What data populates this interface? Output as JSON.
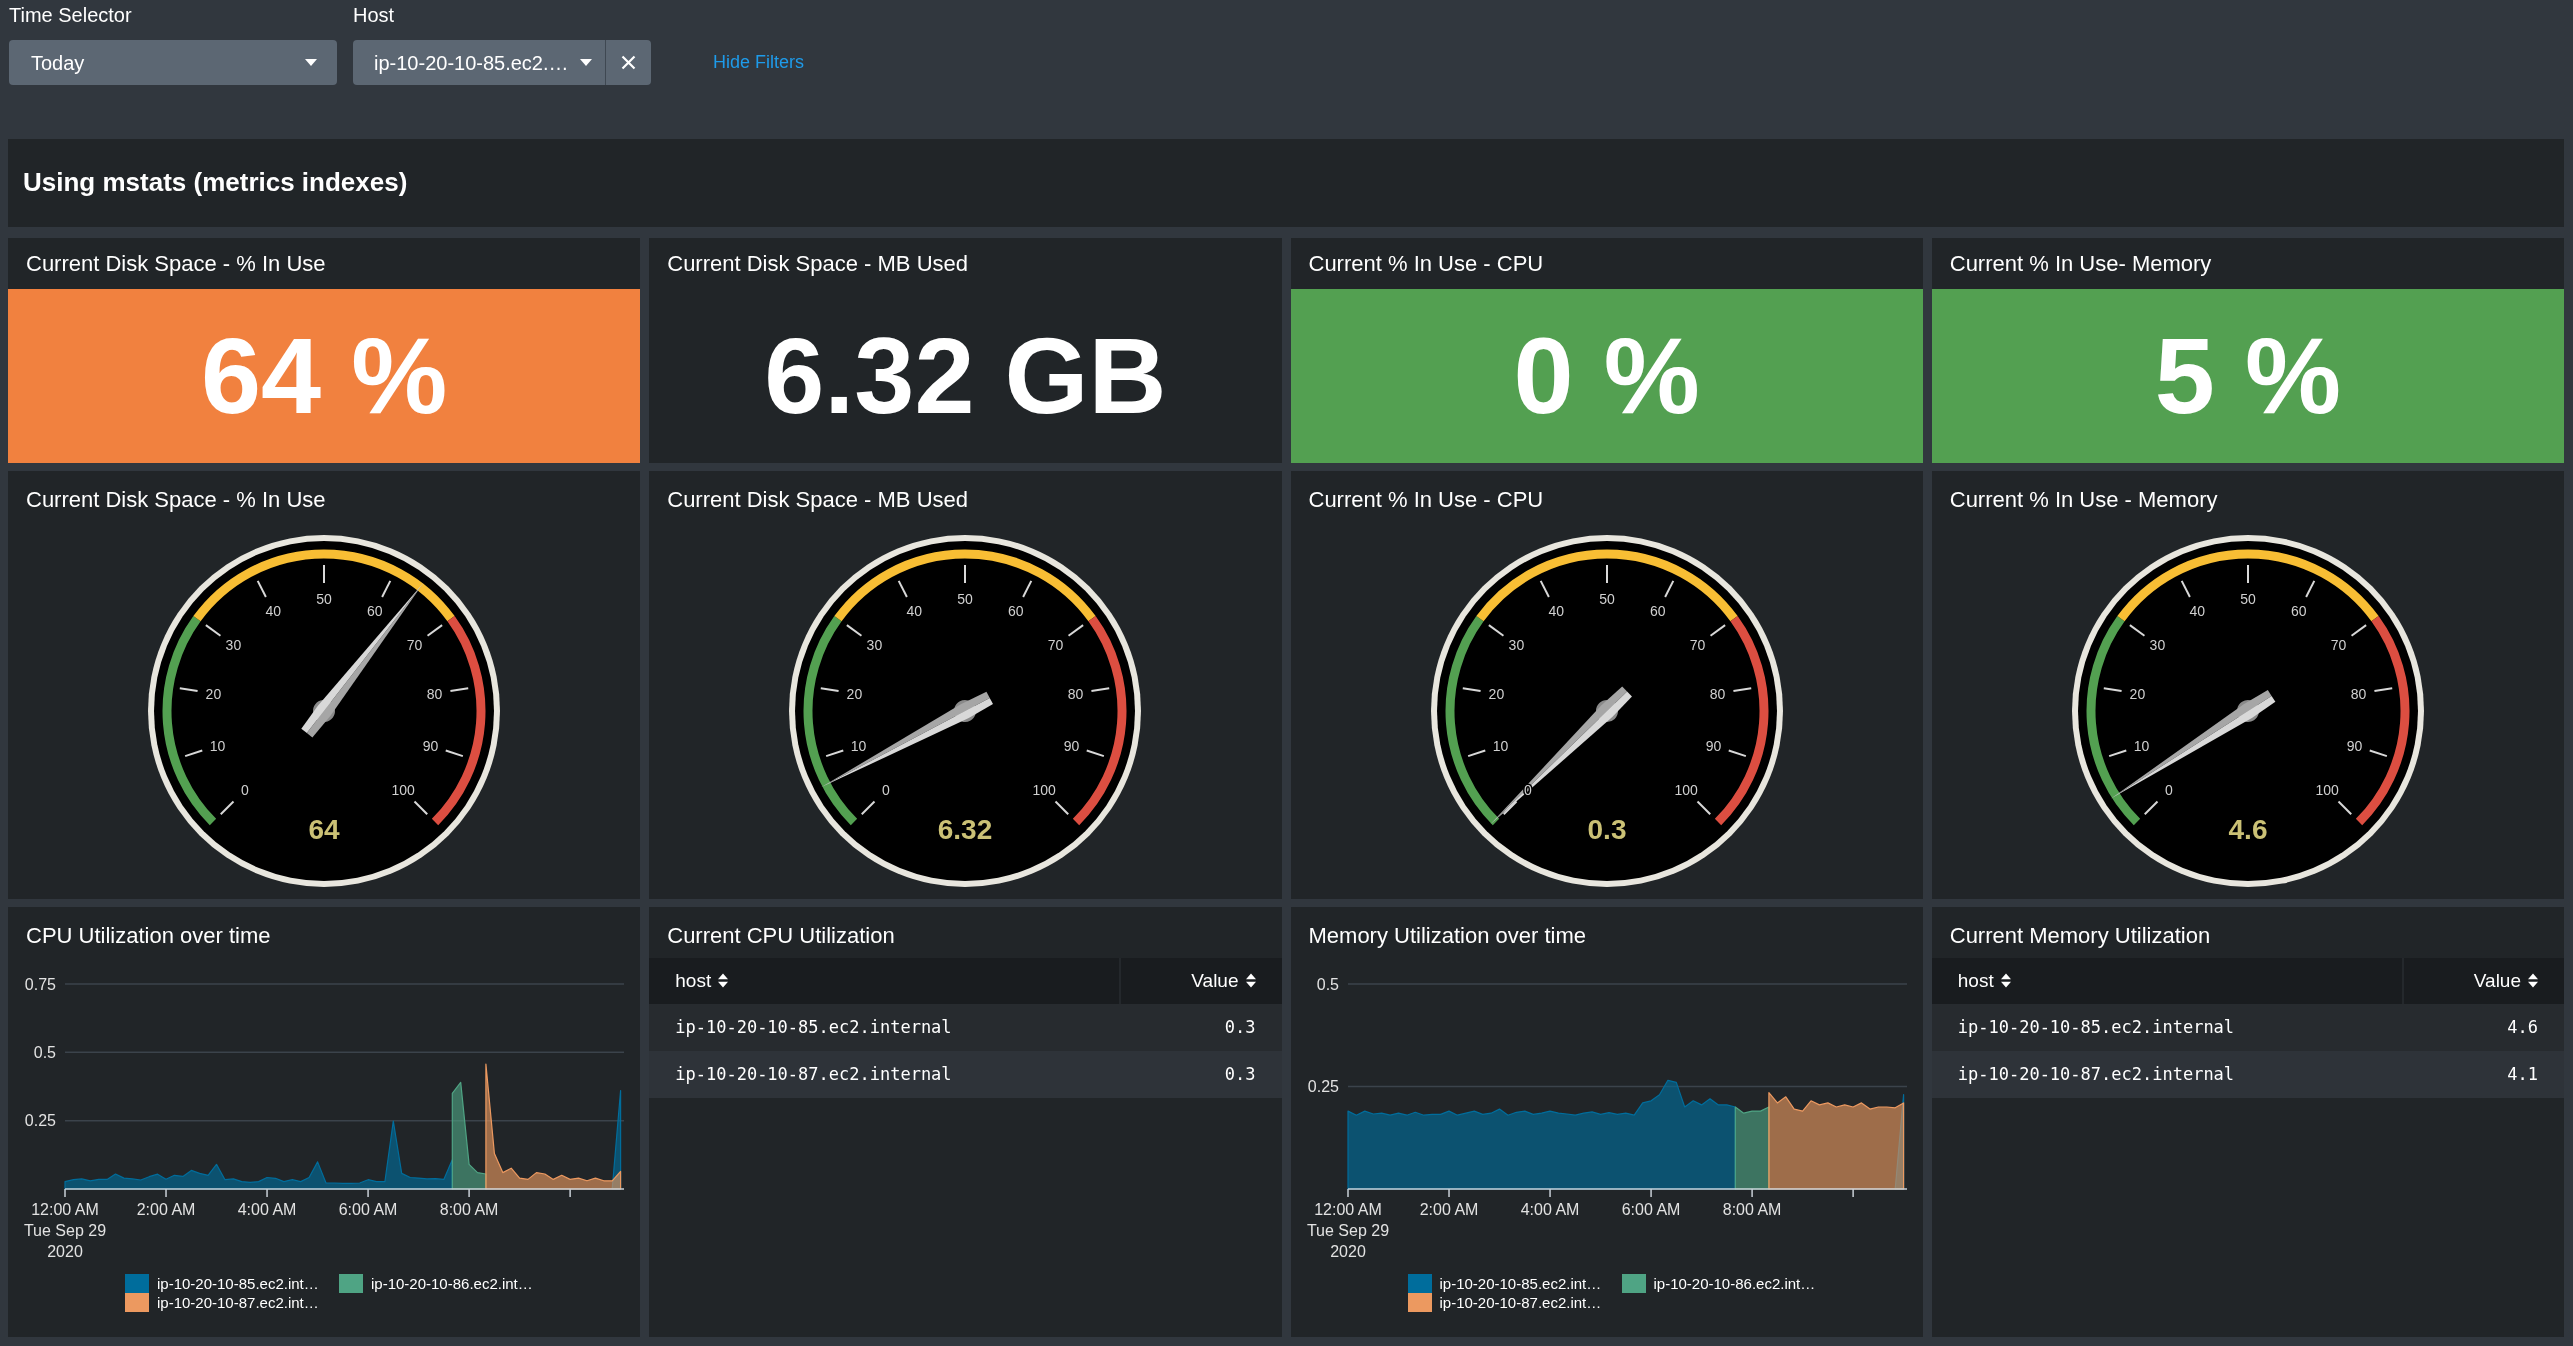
{
  "filters": {
    "inputs": [
      {
        "kind": "dropdown",
        "label": "Time Selector",
        "value": "Today"
      },
      {
        "kind": "multiselect",
        "label": "Host",
        "value": "ip-10-20-10-85.ec2.…"
      }
    ],
    "toggle_link": "Hide Filters"
  },
  "dashboard": {
    "title": "Using mstats (metrics indexes)",
    "rows": [
      {
        "panels": [
          {
            "kind": "single_value",
            "title": "Current Disk Space - % In Use",
            "value": "64 %",
            "color": "#f1813f"
          },
          {
            "kind": "single_value",
            "title": "Current Disk Space - MB Used",
            "value": "6.32 GB"
          },
          {
            "kind": "single_value",
            "title": "Current % In Use - CPU",
            "value": "0 %",
            "color": "#53a051"
          },
          {
            "kind": "single_value",
            "title": "Current % In Use- Memory",
            "value": "5 %",
            "color": "#53a051"
          }
        ]
      },
      {
        "panels": [
          {
            "kind": "gauge",
            "title": "Current Disk Space - % In Use",
            "ticks": [
              "0",
              "10",
              "20",
              "30",
              "40",
              "50",
              "60",
              "70",
              "80",
              "90",
              "100"
            ],
            "reading": "64"
          },
          {
            "kind": "gauge",
            "title": "Current Disk Space - MB Used",
            "ticks": [
              "0",
              "10",
              "20",
              "30",
              "40",
              "50",
              "60",
              "70",
              "80",
              "90",
              "100"
            ],
            "reading": "6.32"
          },
          {
            "kind": "gauge",
            "title": "Current % In Use - CPU",
            "ticks": [
              "0",
              "10",
              "20",
              "30",
              "40",
              "50",
              "60",
              "70",
              "80",
              "90",
              "100"
            ],
            "reading": "0.3"
          },
          {
            "kind": "gauge",
            "title": "Current % In Use - Memory",
            "ticks": [
              "0",
              "10",
              "20",
              "30",
              "40",
              "50",
              "60",
              "70",
              "80",
              "90",
              "100"
            ],
            "reading": "4.6"
          }
        ]
      },
      {
        "panels": [
          {
            "kind": "chart",
            "title": "CPU Utilization over time",
            "chart_data": {
              "type": "area",
              "x": [
                0,
                10,
                20,
                30,
                40,
                50,
                60,
                70,
                80,
                90,
                100,
                110,
                120,
                130,
                140,
                150,
                160,
                170,
                180,
                190,
                200,
                210,
                220,
                230,
                240,
                250,
                260,
                270,
                280,
                290,
                300,
                310,
                320,
                330,
                340,
                350,
                360,
                370,
                380,
                390,
                400,
                410,
                420,
                430,
                440,
                450,
                460,
                470,
                480,
                490,
                500,
                510,
                520,
                530,
                540,
                550,
                560,
                570,
                580,
                590,
                600,
                610,
                620,
                630,
                640,
                650,
                660
              ],
              "xlim": [
                0,
                664
              ],
              "ylim": [
                0,
                0.75
              ],
              "xticks": [
                {
                  "value": 0,
                  "label": "12:00 AM\nTue Sep 29\n2020"
                },
                {
                  "value": 120,
                  "label": "2:00 AM"
                },
                {
                  "value": 240,
                  "label": "4:00 AM"
                },
                {
                  "value": 360,
                  "label": "6:00 AM"
                },
                {
                  "value": 480,
                  "label": "8:00 AM"
                }
              ],
              "yticks": [
                0.25,
                0.5,
                0.75
              ],
              "series": [
                {
                  "name": "ip-10-20-10-85.ec2.int…",
                  "color": "#006d9c",
                  "values": [
                    0.027,
                    0.034,
                    0.037,
                    0.03,
                    0.035,
                    0.035,
                    0.055,
                    0.04,
                    0.037,
                    0.033,
                    0.045,
                    0.054,
                    0.036,
                    0.05,
                    0.046,
                    0.068,
                    0.057,
                    0.05,
                    0.09,
                    0.034,
                    0.037,
                    0.027,
                    0.024,
                    0.027,
                    0.042,
                    0.039,
                    0.027,
                    0.034,
                    0.027,
                    0.042,
                    0.099,
                    0.022,
                    0.022,
                    0.021,
                    0.021,
                    0.022,
                    0.034,
                    0.027,
                    0.027,
                    0.248,
                    0.057,
                    0.042,
                    0.04,
                    0.037,
                    0.038,
                    0.035,
                    0.107,
                    null,
                    null,
                    null,
                    null,
                    null,
                    null,
                    null,
                    null,
                    null,
                    null,
                    null,
                    null,
                    null,
                    null,
                    null,
                    null,
                    null,
                    null,
                    0,
                    0.36
                  ]
                },
                {
                  "name": "ip-10-20-10-86.ec2.int…",
                  "color": "#4fa484",
                  "values": [
                    null,
                    null,
                    null,
                    null,
                    null,
                    null,
                    null,
                    null,
                    null,
                    null,
                    null,
                    null,
                    null,
                    null,
                    null,
                    null,
                    null,
                    null,
                    null,
                    null,
                    null,
                    null,
                    null,
                    null,
                    null,
                    null,
                    null,
                    null,
                    null,
                    null,
                    null,
                    null,
                    null,
                    null,
                    null,
                    null,
                    null,
                    null,
                    null,
                    null,
                    null,
                    null,
                    null,
                    null,
                    null,
                    null,
                    0.35,
                    0.39,
                    0.09,
                    0.06,
                    0.055,
                    null,
                    null,
                    null,
                    null,
                    null,
                    null,
                    null,
                    null,
                    null,
                    null,
                    null,
                    null,
                    null,
                    null,
                    null,
                    null
                  ]
                },
                {
                  "name": "ip-10-20-10-87.ec2.int…",
                  "color": "#ec9960",
                  "values": [
                    null,
                    null,
                    null,
                    null,
                    null,
                    null,
                    null,
                    null,
                    null,
                    null,
                    null,
                    null,
                    null,
                    null,
                    null,
                    null,
                    null,
                    null,
                    null,
                    null,
                    null,
                    null,
                    null,
                    null,
                    null,
                    null,
                    null,
                    null,
                    null,
                    null,
                    null,
                    null,
                    null,
                    null,
                    null,
                    null,
                    null,
                    null,
                    null,
                    null,
                    null,
                    null,
                    null,
                    null,
                    null,
                    null,
                    null,
                    null,
                    null,
                    null,
                    0.457,
                    0.13,
                    0.06,
                    0.076,
                    0.04,
                    0.035,
                    0.06,
                    0.055,
                    0.035,
                    0.05,
                    0.035,
                    0.04,
                    0.03,
                    0.04,
                    0.03,
                    0.03,
                    0.064
                  ]
                }
              ]
            }
          },
          {
            "kind": "table",
            "title": "Current CPU Utilization",
            "columns": [
              {
                "label": "host",
                "kind": "text"
              },
              {
                "label": "Value",
                "kind": "number"
              }
            ],
            "rows": [
              [
                "ip-10-20-10-85.ec2.internal",
                "0.3"
              ],
              [
                "ip-10-20-10-87.ec2.internal",
                "0.3"
              ]
            ]
          },
          {
            "kind": "chart",
            "title": "Memory Utilization over time",
            "chart_data": {
              "type": "area",
              "x": [
                0,
                10,
                20,
                30,
                40,
                50,
                60,
                70,
                80,
                90,
                100,
                110,
                120,
                130,
                140,
                150,
                160,
                170,
                180,
                190,
                200,
                210,
                220,
                230,
                240,
                250,
                260,
                270,
                280,
                290,
                300,
                310,
                320,
                330,
                340,
                350,
                360,
                370,
                380,
                390,
                400,
                410,
                420,
                430,
                440,
                450,
                460,
                470,
                480,
                490,
                500,
                510,
                520,
                530,
                540,
                550,
                560,
                570,
                580,
                590,
                600,
                610,
                620,
                630,
                640,
                650,
                660
              ],
              "xlim": [
                0,
                664
              ],
              "ylim": [
                0,
                0.5
              ],
              "xticks": [
                {
                  "value": 0,
                  "label": "12:00 AM\nTue Sep 29\n2020"
                },
                {
                  "value": 120,
                  "label": "2:00 AM"
                },
                {
                  "value": 240,
                  "label": "4:00 AM"
                },
                {
                  "value": 360,
                  "label": "6:00 AM"
                },
                {
                  "value": 480,
                  "label": "8:00 AM"
                }
              ],
              "yticks": [
                0.25,
                0.5
              ],
              "series": [
                {
                  "name": "ip-10-20-10-85.ec2.int…",
                  "color": "#006d9c",
                  "values": [
                    0.19,
                    0.18,
                    0.19,
                    0.183,
                    0.185,
                    0.18,
                    0.185,
                    0.18,
                    0.187,
                    0.18,
                    0.182,
                    0.182,
                    0.19,
                    0.18,
                    0.185,
                    0.19,
                    0.182,
                    0.185,
                    0.195,
                    0.18,
                    0.187,
                    0.19,
                    0.182,
                    0.185,
                    0.19,
                    0.185,
                    0.183,
                    0.18,
                    0.185,
                    0.188,
                    0.182,
                    0.186,
                    0.182,
                    0.185,
                    0.18,
                    0.21,
                    0.215,
                    0.23,
                    0.265,
                    0.26,
                    0.2,
                    0.215,
                    0.205,
                    0.22,
                    0.205,
                    0.205,
                    0.2,
                    null,
                    null,
                    null,
                    null,
                    null,
                    null,
                    null,
                    null,
                    null,
                    null,
                    null,
                    null,
                    null,
                    null,
                    null,
                    null,
                    null,
                    null,
                    0,
                    0.23
                  ]
                },
                {
                  "name": "ip-10-20-10-86.ec2.int…",
                  "color": "#4fa484",
                  "values": [
                    null,
                    null,
                    null,
                    null,
                    null,
                    null,
                    null,
                    null,
                    null,
                    null,
                    null,
                    null,
                    null,
                    null,
                    null,
                    null,
                    null,
                    null,
                    null,
                    null,
                    null,
                    null,
                    null,
                    null,
                    null,
                    null,
                    null,
                    null,
                    null,
                    null,
                    null,
                    null,
                    null,
                    null,
                    null,
                    null,
                    null,
                    null,
                    null,
                    null,
                    null,
                    null,
                    null,
                    null,
                    null,
                    null,
                    0.2,
                    0.185,
                    0.19,
                    0.19,
                    0.2,
                    null,
                    null,
                    null,
                    null,
                    null,
                    null,
                    null,
                    null,
                    null,
                    null,
                    null,
                    null,
                    null,
                    null,
                    null,
                    null
                  ]
                },
                {
                  "name": "ip-10-20-10-87.ec2.int…",
                  "color": "#ec9960",
                  "values": [
                    null,
                    null,
                    null,
                    null,
                    null,
                    null,
                    null,
                    null,
                    null,
                    null,
                    null,
                    null,
                    null,
                    null,
                    null,
                    null,
                    null,
                    null,
                    null,
                    null,
                    null,
                    null,
                    null,
                    null,
                    null,
                    null,
                    null,
                    null,
                    null,
                    null,
                    null,
                    null,
                    null,
                    null,
                    null,
                    null,
                    null,
                    null,
                    null,
                    null,
                    null,
                    null,
                    null,
                    null,
                    null,
                    null,
                    null,
                    null,
                    null,
                    null,
                    0.235,
                    0.21,
                    0.225,
                    0.195,
                    0.19,
                    0.215,
                    0.205,
                    0.21,
                    0.2,
                    0.205,
                    0.2,
                    0.21,
                    0.195,
                    0.2,
                    0.2,
                    0.198,
                    0.21
                  ]
                }
              ]
            }
          },
          {
            "kind": "table",
            "title": "Current Memory Utilization",
            "columns": [
              {
                "label": "host",
                "kind": "text"
              },
              {
                "label": "Value",
                "kind": "number"
              }
            ],
            "rows": [
              [
                "ip-10-20-10-85.ec2.internal",
                "4.6"
              ],
              [
                "ip-10-20-10-87.ec2.internal",
                "4.1"
              ]
            ]
          }
        ]
      }
    ]
  }
}
